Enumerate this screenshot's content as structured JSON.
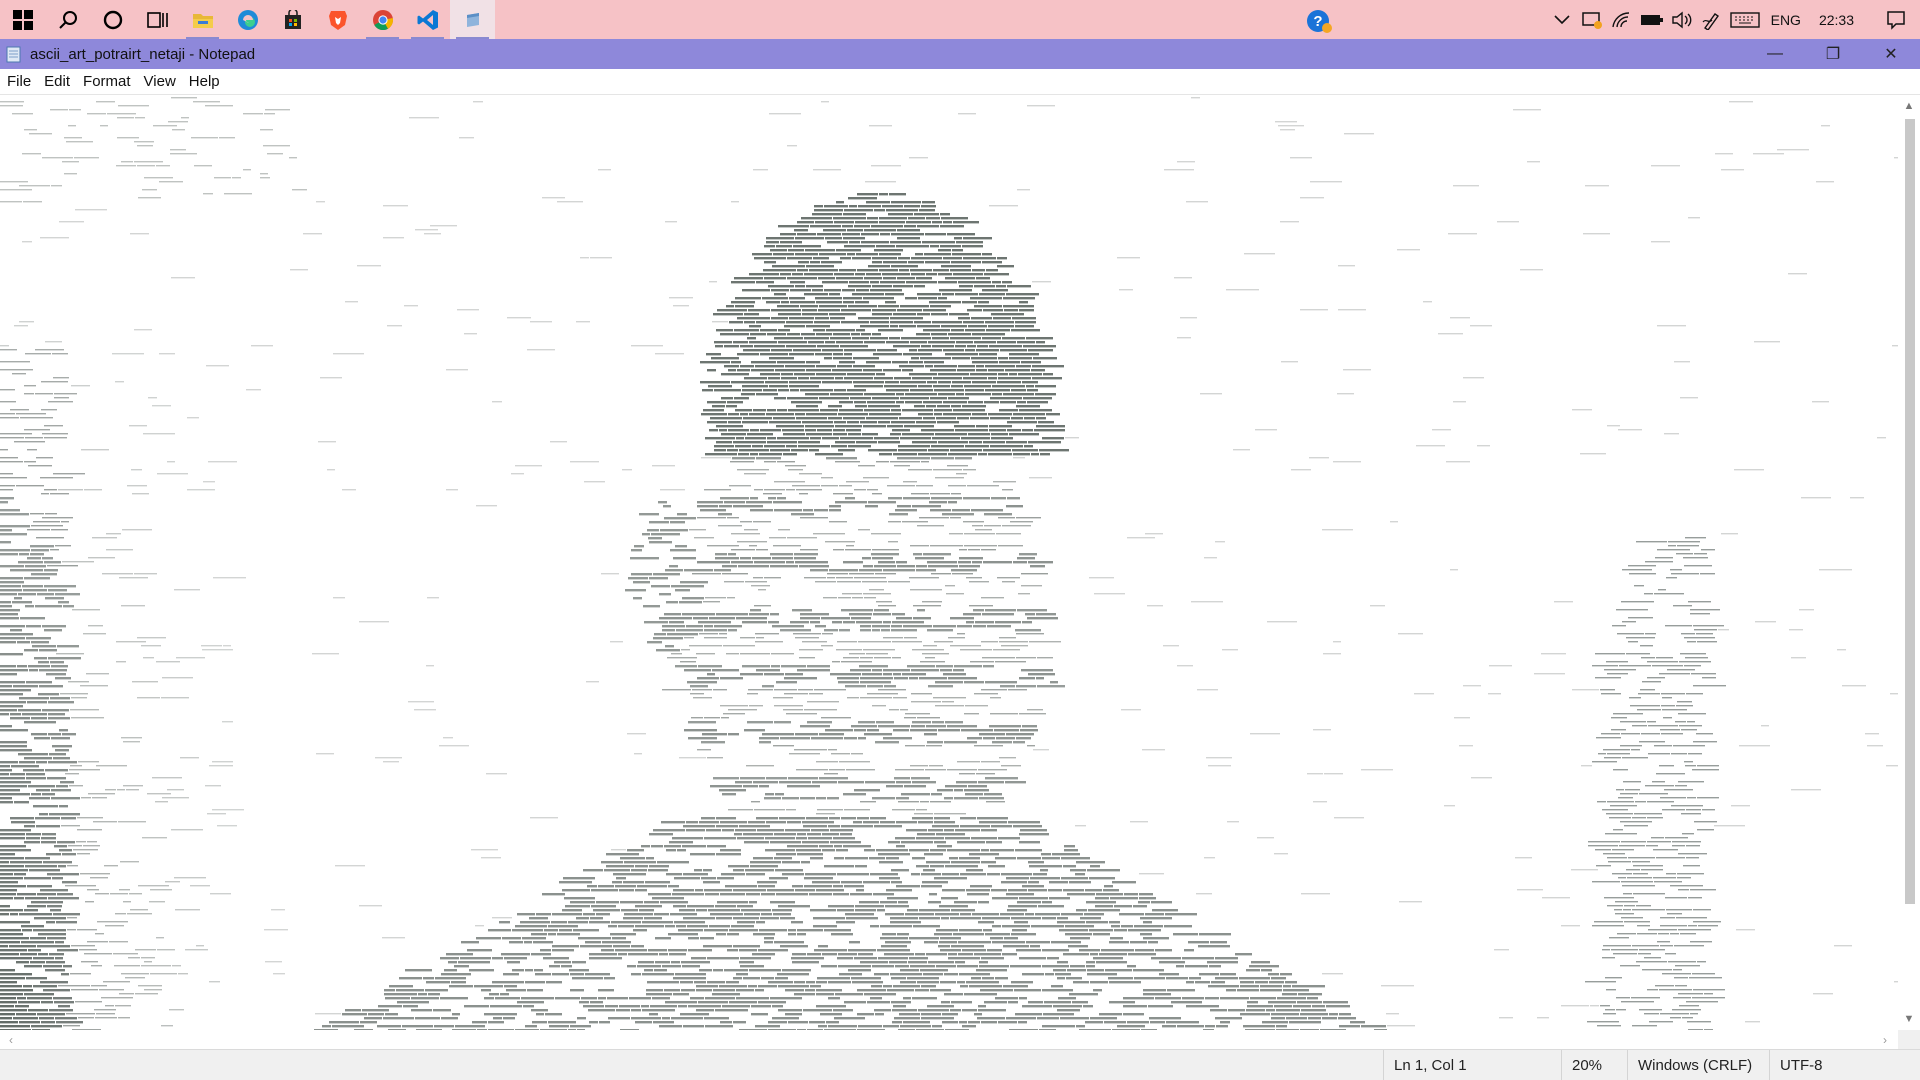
{
  "taskbar": {
    "apps": [
      {
        "name": "start-button",
        "icon": "windows-logo-icon"
      },
      {
        "name": "search-button",
        "icon": "search-icon"
      },
      {
        "name": "cortana-button",
        "icon": "cortana-circle-icon"
      },
      {
        "name": "task-view-button",
        "icon": "task-view-icon"
      },
      {
        "name": "file-explorer-button",
        "icon": "folder-icon"
      },
      {
        "name": "edge-button",
        "icon": "edge-icon"
      },
      {
        "name": "store-button",
        "icon": "store-bag-icon"
      },
      {
        "name": "brave-button",
        "icon": "brave-lion-icon"
      },
      {
        "name": "chrome-button",
        "icon": "chrome-icon"
      },
      {
        "name": "vscode-button",
        "icon": "vscode-icon"
      },
      {
        "name": "notepad-button",
        "icon": "notepad-icon"
      }
    ],
    "tray": {
      "language": "ENG",
      "time": "22:33"
    }
  },
  "window": {
    "title": "ascii_art_potrairt_netaji - Notepad",
    "controls": {
      "minimize": "—",
      "maximize": "❐",
      "close": "✕"
    }
  },
  "menu": [
    "File",
    "Edit",
    "Format",
    "View",
    "Help"
  ],
  "status": {
    "position": "Ln 1, Col 1",
    "zoom": "20%",
    "line_ending": "Windows (CRLF)",
    "encoding": "UTF-8"
  },
  "colors": {
    "taskbar_bg": "#f6c2c6",
    "titlebar_bg": "#8e88da",
    "ascii_ink": "#5b6460"
  }
}
